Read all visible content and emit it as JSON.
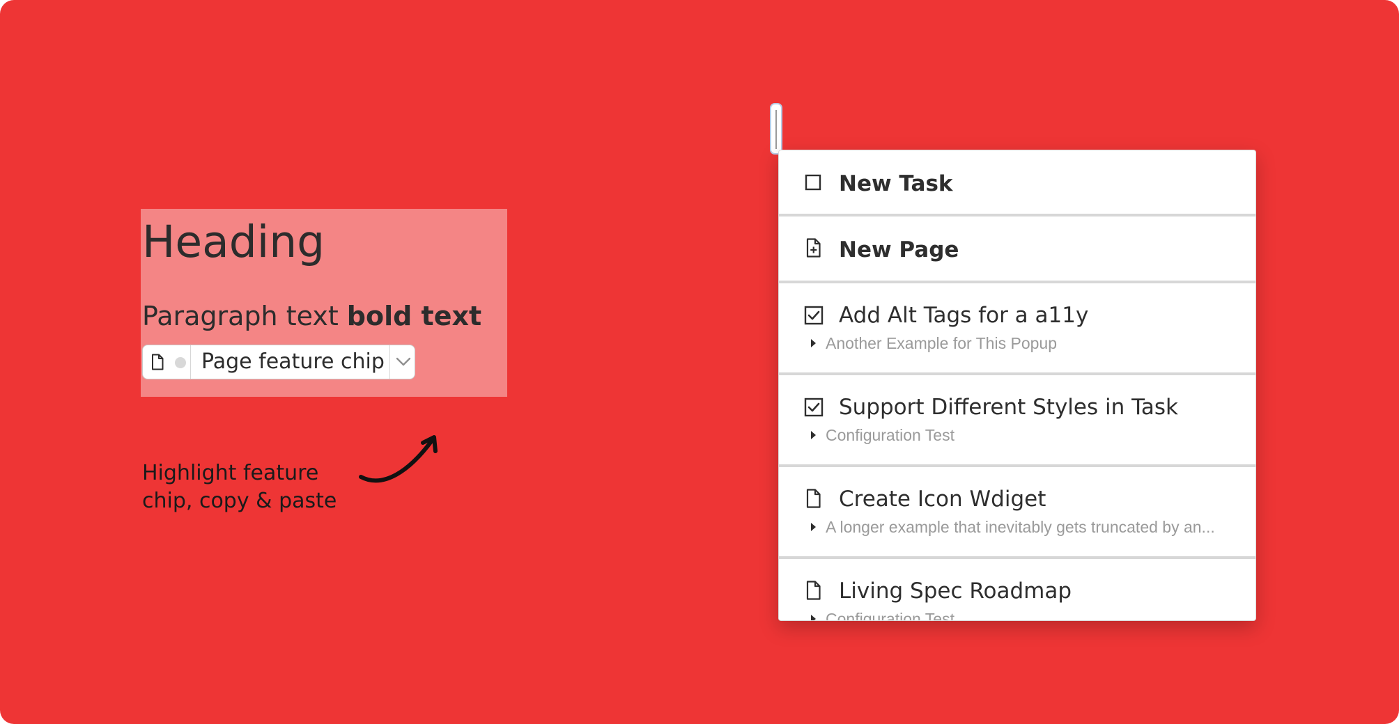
{
  "heading": "Heading",
  "paragraph": {
    "regular": "Paragraph text ",
    "bold": "bold text"
  },
  "chip": {
    "label": "Page feature chip",
    "icon": "file-icon",
    "toggle_icon": "chevron-down-icon"
  },
  "instruction": {
    "line1": "Highlight feature",
    "line2": "chip, copy & paste"
  },
  "colors": {
    "background": "#ee3535",
    "selection": "#f48585",
    "text": "#2c2c2c",
    "muted": "#9a9a9a"
  },
  "popup": {
    "items": [
      {
        "icon": "checkbox-empty-icon",
        "title": "New Task",
        "bold": true
      },
      {
        "icon": "file-plus-icon",
        "title": "New Page",
        "bold": true
      },
      {
        "icon": "checkbox-checked-icon",
        "title": "Add Alt Tags for a a11y",
        "subtitle": "Another Example for This Popup"
      },
      {
        "icon": "checkbox-checked-icon",
        "title": "Support Different Styles in Task",
        "subtitle": "Configuration Test"
      },
      {
        "icon": "file-icon",
        "title": "Create Icon Wdiget",
        "subtitle": "A longer example that inevitably gets truncated by an..."
      },
      {
        "icon": "file-icon",
        "title": "Living Spec Roadmap",
        "subtitle": "Configuration Test"
      }
    ]
  }
}
